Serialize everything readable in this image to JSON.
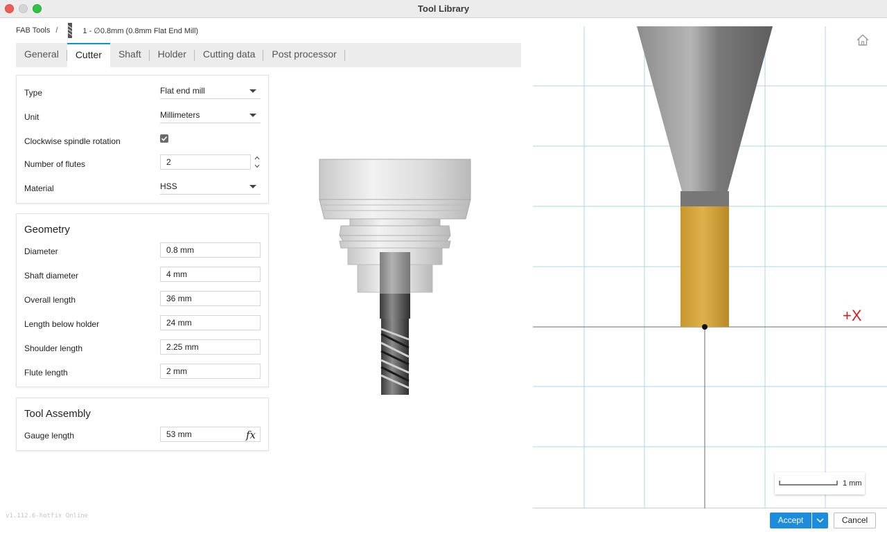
{
  "window": {
    "title": "Tool Library"
  },
  "breadcrumb": {
    "root": "FAB Tools",
    "separator": "/",
    "tool": "1 - ∅0.8mm (0.8mm Flat End Mill)"
  },
  "tabs": [
    "General",
    "Cutter",
    "Shaft",
    "Holder",
    "Cutting data",
    "Post processor"
  ],
  "active_tab": "Cutter",
  "cutter": {
    "type_label": "Type",
    "type_value": "Flat end mill",
    "unit_label": "Unit",
    "unit_value": "Millimeters",
    "clockwise_label": "Clockwise spindle rotation",
    "clockwise_checked": true,
    "flutes_label": "Number of flutes",
    "flutes_value": "2",
    "material_label": "Material",
    "material_value": "HSS"
  },
  "geometry": {
    "title": "Geometry",
    "diameter_label": "Diameter",
    "diameter_value": "0.8 mm",
    "shaft_diameter_label": "Shaft diameter",
    "shaft_diameter_value": "4 mm",
    "overall_length_label": "Overall length",
    "overall_length_value": "36 mm",
    "length_below_holder_label": "Length below holder",
    "length_below_holder_value": "24 mm",
    "shoulder_length_label": "Shoulder length",
    "shoulder_length_value": "2.25 mm",
    "flute_length_label": "Flute length",
    "flute_length_value": "2 mm"
  },
  "assembly": {
    "title": "Tool Assembly",
    "gauge_length_label": "Gauge length",
    "gauge_length_value": "53 mm",
    "fx_label": "fx"
  },
  "viewport": {
    "axis_label": "+X",
    "scale_label": "1 mm",
    "cutter_color": "#d4a53d"
  },
  "footer": {
    "version": "v1.112.6-hotfix Online",
    "accept": "Accept",
    "cancel": "Cancel"
  },
  "colors": {
    "accent": "#1e8cdc",
    "axis_x": "#d01f1f",
    "grid": "#a8d4e8"
  }
}
